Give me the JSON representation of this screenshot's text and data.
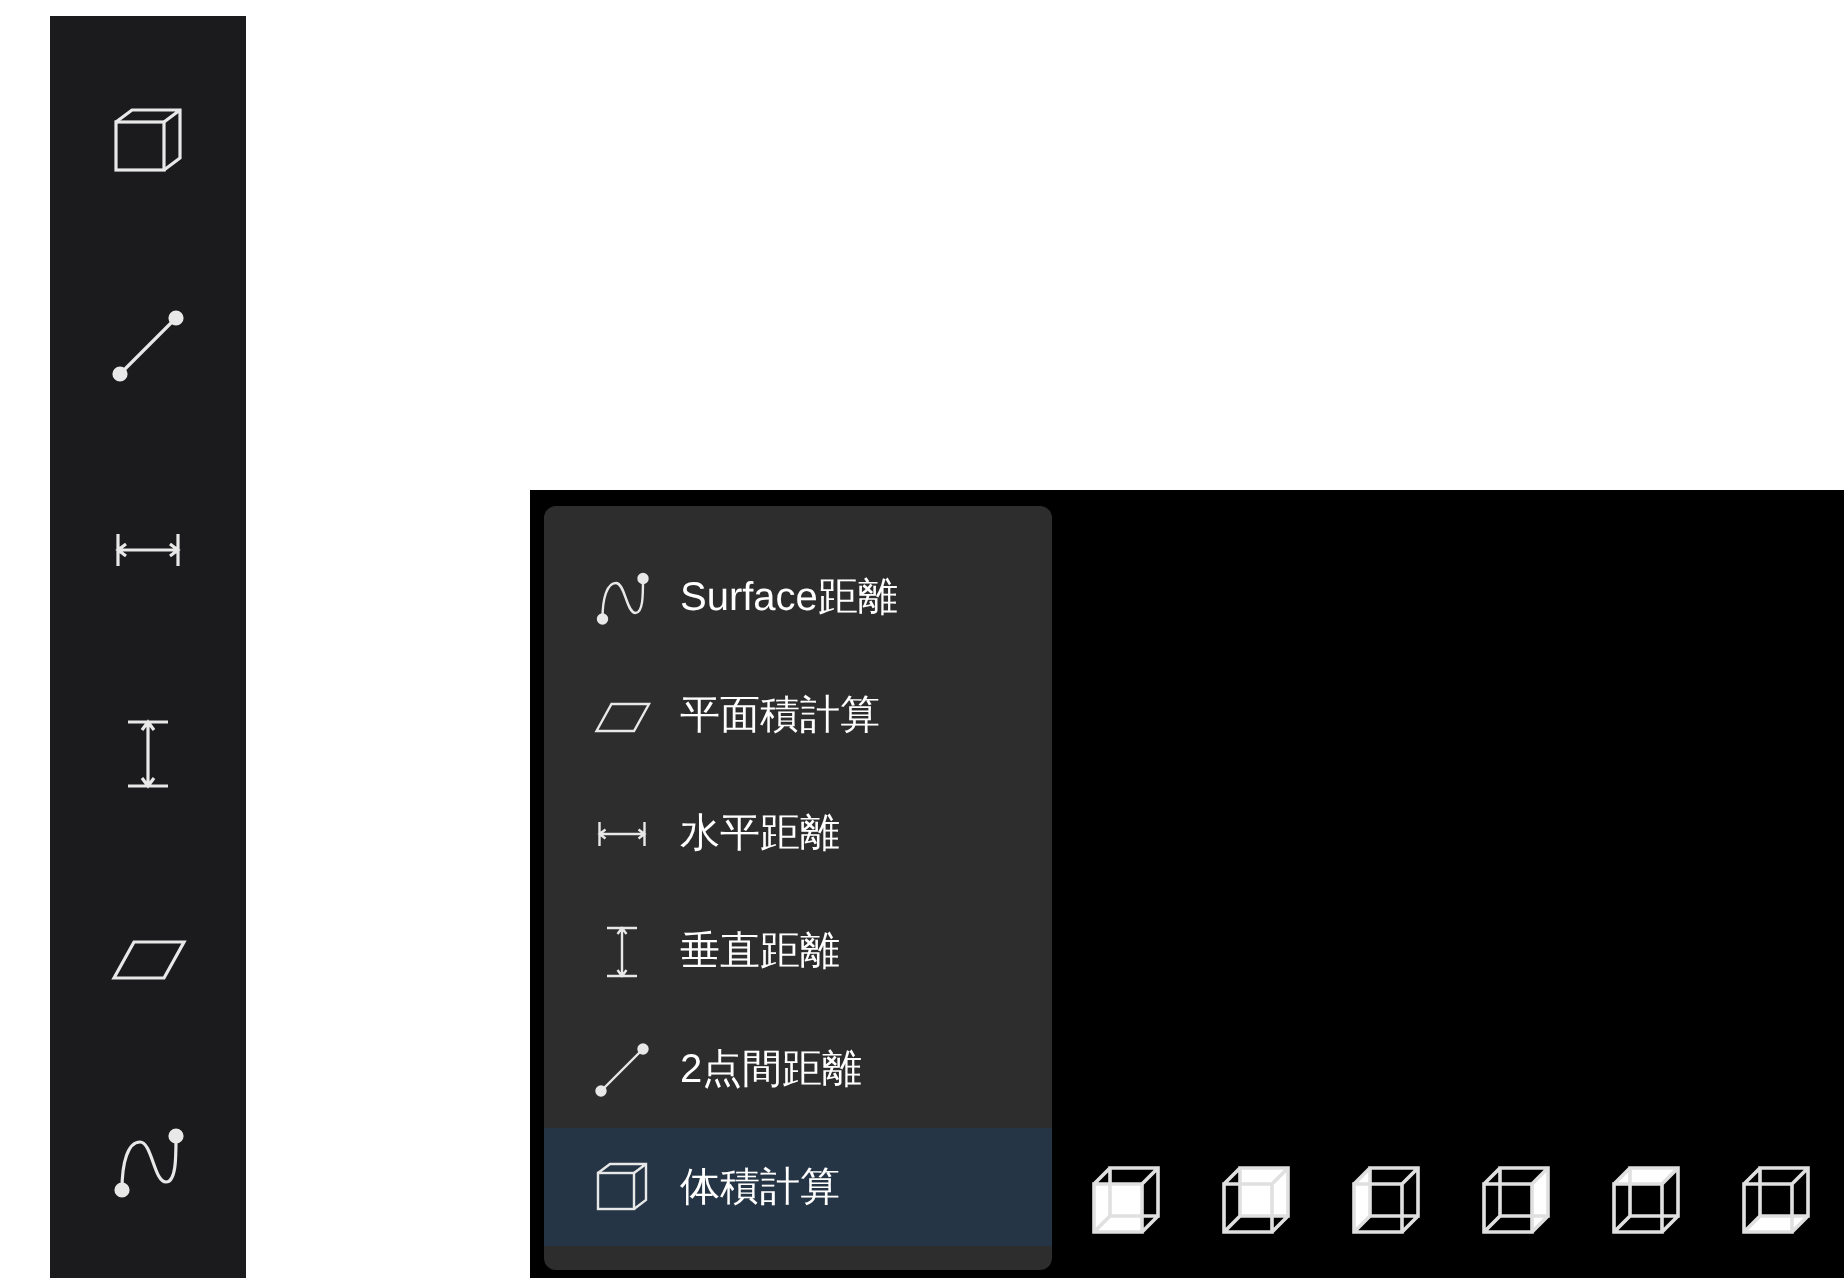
{
  "sidebar": {
    "tools": [
      {
        "kind": "cube"
      },
      {
        "kind": "line"
      },
      {
        "kind": "horizontal"
      },
      {
        "kind": "vertical"
      },
      {
        "kind": "plane"
      },
      {
        "kind": "curve"
      }
    ]
  },
  "menu": {
    "items": [
      {
        "kind": "curve",
        "label": "Surface距離",
        "selected": false
      },
      {
        "kind": "plane",
        "label": "平面積計算",
        "selected": false
      },
      {
        "kind": "horizontal",
        "label": "水平距離",
        "selected": false
      },
      {
        "kind": "vertical",
        "label": "垂直距離",
        "selected": false
      },
      {
        "kind": "line",
        "label": "2点間距離",
        "selected": false
      },
      {
        "kind": "cube",
        "label": "体積計算",
        "selected": true
      }
    ]
  },
  "view_cubes": [
    {
      "kind": "front"
    },
    {
      "kind": "back"
    },
    {
      "kind": "left"
    },
    {
      "kind": "right"
    },
    {
      "kind": "top"
    },
    {
      "kind": "bottom"
    }
  ]
}
